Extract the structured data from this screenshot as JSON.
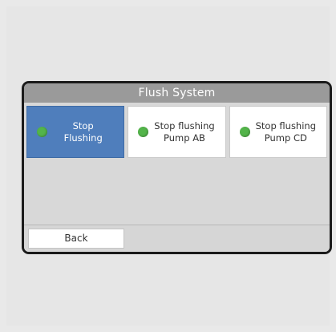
{
  "window": {
    "title": "Flush System"
  },
  "tiles": [
    {
      "label": "Stop\nFlushing",
      "status_icon": "green-status-led",
      "selected": true
    },
    {
      "label": "Stop flushing\nPump AB",
      "status_icon": "green-status-led",
      "selected": false
    },
    {
      "label": "Stop flushing\nPump CD",
      "status_icon": "green-status-led",
      "selected": false
    }
  ],
  "footer": {
    "back_label": "Back"
  },
  "colors": {
    "title_bar": "#9a9a9a",
    "selected_tile": "#4f7ebc",
    "status_led": "#53b44a",
    "bezel": "#1b1b1b"
  }
}
